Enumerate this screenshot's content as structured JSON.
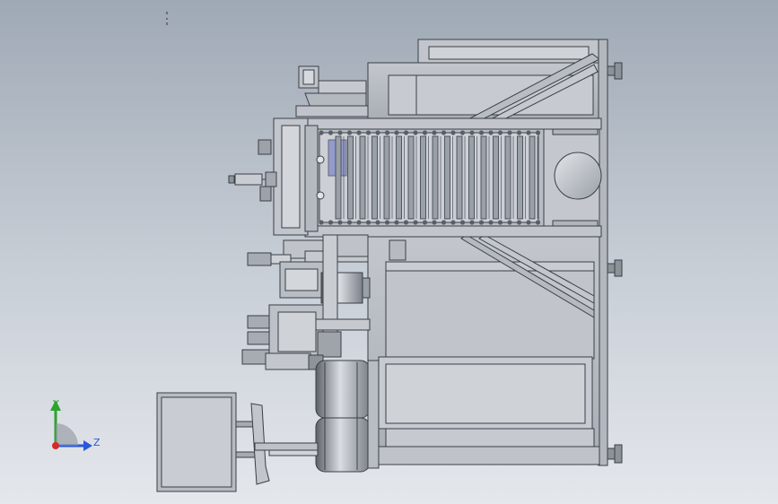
{
  "viewport": {
    "background_top": "#9fa9b5",
    "background_bottom": "#e4e7ec",
    "line_color": "#3a3f46",
    "fill_light": "#c8ccd2",
    "fill_mid": "#9fa4ab",
    "fill_dark": "#6f747b"
  },
  "triad": {
    "y_label": "Y",
    "z_label": "Z",
    "y_color": "#2ea32e",
    "z_color": "#2a58d8",
    "origin_color": "#d42a2a"
  }
}
